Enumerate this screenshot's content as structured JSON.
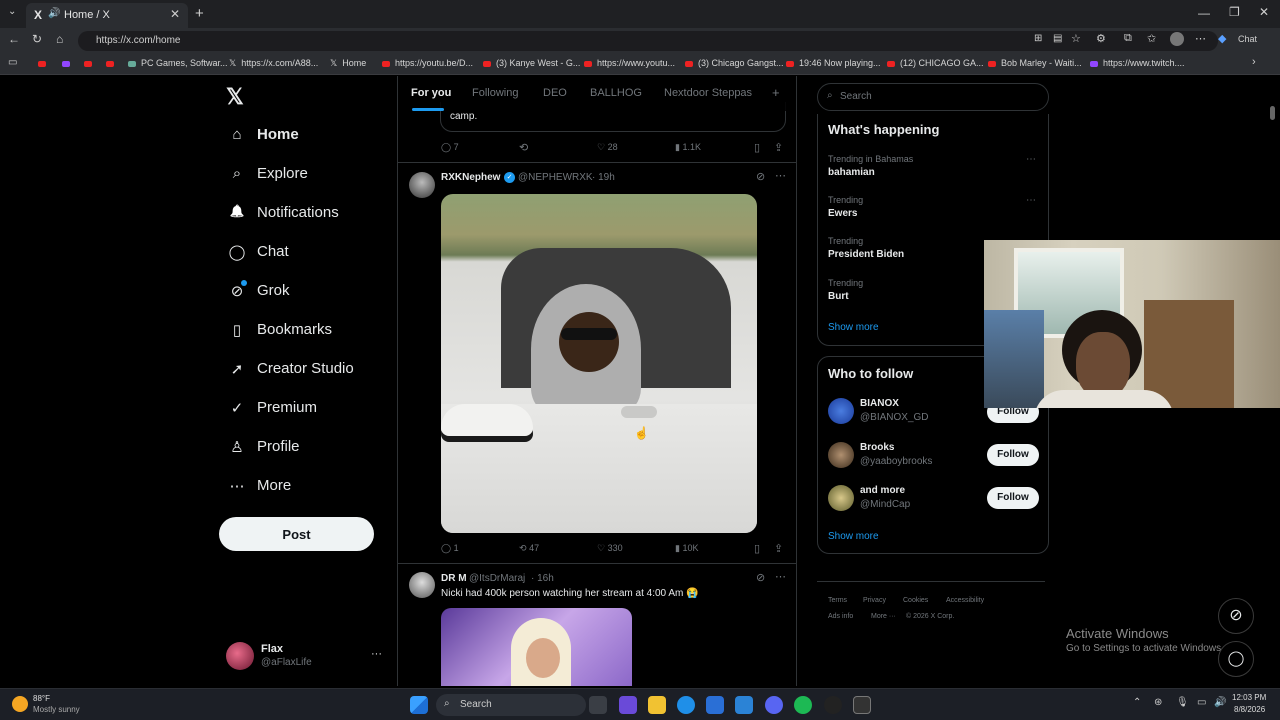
{
  "browser": {
    "tab_title": "Home / X",
    "tab_icon": "X",
    "url": "https://x.com/home",
    "chat_label": "Chat",
    "bookmarks": [
      "PC Games, Softwar...",
      "https://x.com/A88...",
      "Home",
      "https://youtu.be/D...",
      "(3) Kanye West - G...",
      "https://www.youtu...",
      "(3) Chicago Gangst...",
      "19:46 Now playing...",
      "(12) CHICAGO GA...",
      "Bob Marley - Waiti...",
      "https://www.twitch...."
    ]
  },
  "sidebar": {
    "logo": "𝕏",
    "items": [
      {
        "label": "Home",
        "icon": "⌂"
      },
      {
        "label": "Explore",
        "icon": "⌕"
      },
      {
        "label": "Notifications",
        "icon": "🔔"
      },
      {
        "label": "Chat",
        "icon": "◯"
      },
      {
        "label": "Grok",
        "icon": "⊘"
      },
      {
        "label": "Bookmarks",
        "icon": "▯"
      },
      {
        "label": "Creator Studio",
        "icon": "➚"
      },
      {
        "label": "Premium",
        "icon": "✓"
      },
      {
        "label": "Profile",
        "icon": "♙"
      },
      {
        "label": "More",
        "icon": "⋯"
      }
    ],
    "post_label": "Post",
    "account": {
      "name": "Flax",
      "handle": "@aFlaxLife",
      "more": "···"
    }
  },
  "feed": {
    "tabs": [
      "For you",
      "Following",
      "DEO",
      "BALLHOG",
      "Nextdoor Steppas"
    ],
    "add_tab": "+",
    "prev_post": {
      "text_fragment": "camp.",
      "replies": "7",
      "likes": "28",
      "views": "1.1K"
    },
    "post1": {
      "name": "RXKNephew",
      "handle": "@NEPHEWRXK",
      "time": "· 19h",
      "replies": "1",
      "reposts": "47",
      "likes": "330",
      "views": "10K"
    },
    "post2": {
      "name": "DR M",
      "handle": "@ItsDrMaraj",
      "time": "· 16h",
      "text": "Nicki had 400k person watching her stream at 4:00 Am 😭"
    }
  },
  "right": {
    "search_placeholder": "Search",
    "happening_title": "What's happening",
    "trends": [
      {
        "meta": "Trending in Bahamas",
        "name": "bahamian"
      },
      {
        "meta": "Trending",
        "name": "Ewers"
      },
      {
        "meta": "Trending",
        "name": "President Biden"
      },
      {
        "meta": "Trending",
        "name": "Burt"
      }
    ],
    "show_more": "Show more",
    "who_title": "Who to follow",
    "follow": [
      {
        "name": "BIANOX",
        "handle": "@BIANOX_GD",
        "button": "Follow"
      },
      {
        "name": "Brooks",
        "handle": "@yaaboybrooks",
        "button": "Follow"
      },
      {
        "name": "and more",
        "handle": "@MindCap",
        "button": "Follow"
      }
    ],
    "show_more2": "Show more",
    "footer": [
      "Terms",
      "Privacy",
      "Cookies",
      "Accessibility",
      "Ads info",
      "More ···",
      "© 2026 X Corp."
    ]
  },
  "watermark": {
    "title": "Activate Windows",
    "sub": "Go to Settings to activate Windows."
  },
  "taskbar": {
    "weather_temp": "88°F",
    "weather_desc": "Mostly sunny",
    "search": "Search",
    "time": "12:03 PM",
    "date": "8/8/2026"
  }
}
